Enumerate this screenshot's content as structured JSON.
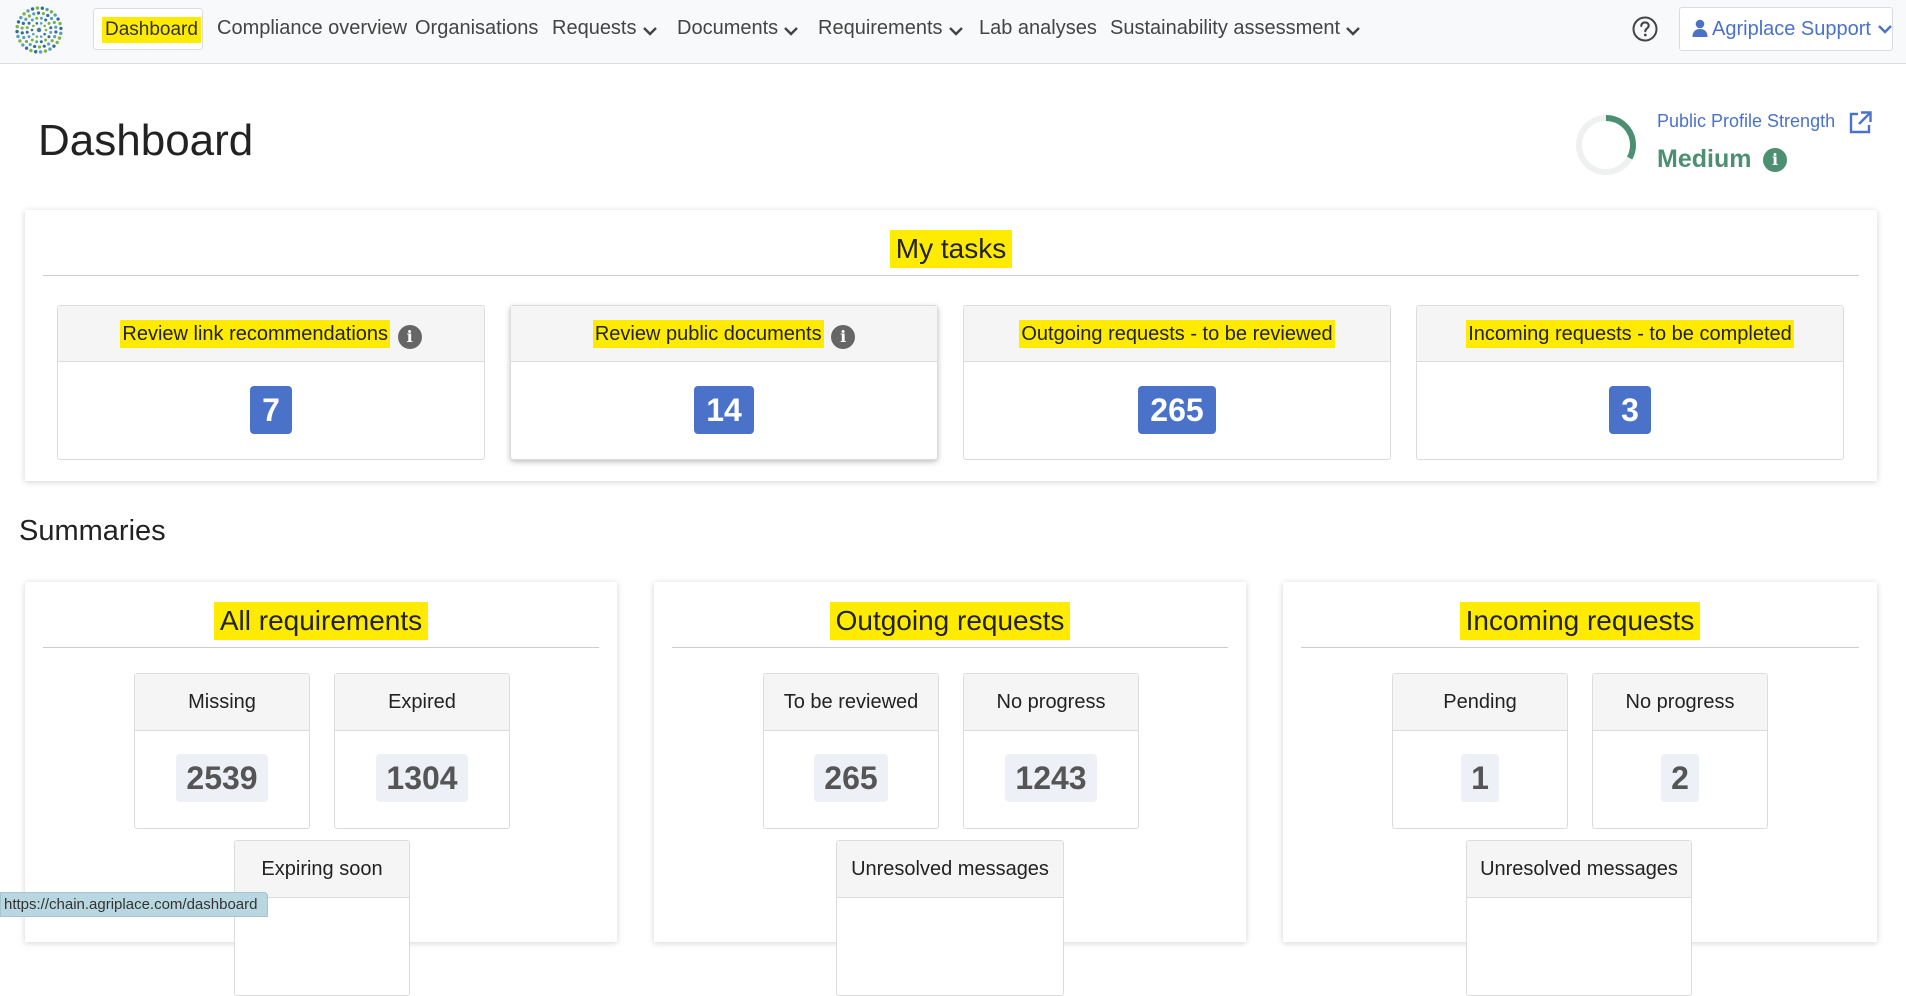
{
  "nav": {
    "items": [
      {
        "label": "Dashboard",
        "dropdown": false,
        "active": true
      },
      {
        "label": "Compliance overview",
        "dropdown": false
      },
      {
        "label": "Organisations",
        "dropdown": false
      },
      {
        "label": "Requests",
        "dropdown": true
      },
      {
        "label": "Documents",
        "dropdown": true
      },
      {
        "label": "Requirements",
        "dropdown": true
      },
      {
        "label": "Lab analyses",
        "dropdown": false
      },
      {
        "label": "Sustainability assessment",
        "dropdown": true
      }
    ],
    "user": "Agriplace Support",
    "help_icon": "help-circle-icon",
    "user_icon": "user-icon"
  },
  "header": {
    "title": "Dashboard",
    "profile_strength_label": "Public Profile Strength",
    "profile_strength_value": "Medium",
    "profile_strength_fraction": 0.33
  },
  "my_tasks": {
    "title": "My tasks",
    "cards": [
      {
        "label": "Review link recommendations",
        "value": "7",
        "info": true
      },
      {
        "label": "Review public documents",
        "value": "14",
        "info": true
      },
      {
        "label": "Outgoing requests - to be reviewed",
        "value": "265",
        "info": false
      },
      {
        "label": "Incoming requests - to be completed",
        "value": "3",
        "info": false
      }
    ]
  },
  "summaries": {
    "title": "Summaries",
    "panels": [
      {
        "title": "All requirements",
        "stats": [
          {
            "label": "Missing",
            "value": "2539"
          },
          {
            "label": "Expired",
            "value": "1304"
          },
          {
            "label": "Expiring soon",
            "value": ""
          }
        ]
      },
      {
        "title": "Outgoing requests",
        "stats": [
          {
            "label": "To be reviewed",
            "value": "265"
          },
          {
            "label": "No progress",
            "value": "1243"
          },
          {
            "label": "Unresolved messages",
            "value": ""
          }
        ]
      },
      {
        "title": "Incoming requests",
        "stats": [
          {
            "label": "Pending",
            "value": "1"
          },
          {
            "label": "No progress",
            "value": "2"
          },
          {
            "label": "Unresolved messages",
            "value": ""
          }
        ]
      }
    ]
  },
  "status_bar_url": "https://chain.agriplace.com/dashboard",
  "colors": {
    "highlight": "#ffeb00",
    "badge_blue": "#4a72c9",
    "profile_green": "#4d8f72",
    "link_blue": "#4a72c9"
  }
}
